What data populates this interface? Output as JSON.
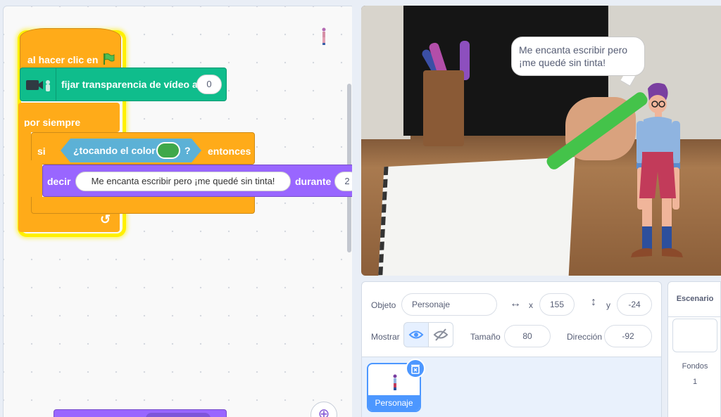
{
  "code": {
    "hat_label": "al hacer clic en",
    "video_label": "fijar transparencia de vídeo a",
    "video_value": "0",
    "forever_label": "por siempre",
    "if_label": "si",
    "sensing_label": "¿tocando el color",
    "sensing_q": "?",
    "then_label": "entonces",
    "touch_color": "#3fa84a",
    "say_label": "decir",
    "say_text": "Me encanta escribir pero ¡me quedé sin tinta!",
    "during_label": "durante",
    "say_secs": "2",
    "zoom_symbol": "⊕"
  },
  "stage": {
    "speech": "Me encanta escribir pero ¡me quedé sin tinta!"
  },
  "sprite_info": {
    "object_label": "Objeto",
    "name": "Personaje",
    "x_label": "x",
    "x_value": "155",
    "y_label": "y",
    "y_value": "-24",
    "show_label": "Mostrar",
    "size_label": "Tamaño",
    "size_value": "80",
    "direction_label": "Dirección",
    "direction_value": "-92"
  },
  "sprites": [
    {
      "name": "Personaje"
    }
  ],
  "stage_pane": {
    "title": "Escenario",
    "backdrops_label": "Fondos",
    "backdrops_count": "1"
  },
  "colors": {
    "events": "#ffab19",
    "video": "#0fbd8c",
    "looks": "#9966ff",
    "sensing": "#5cb1d6",
    "accent": "#4c97ff"
  }
}
